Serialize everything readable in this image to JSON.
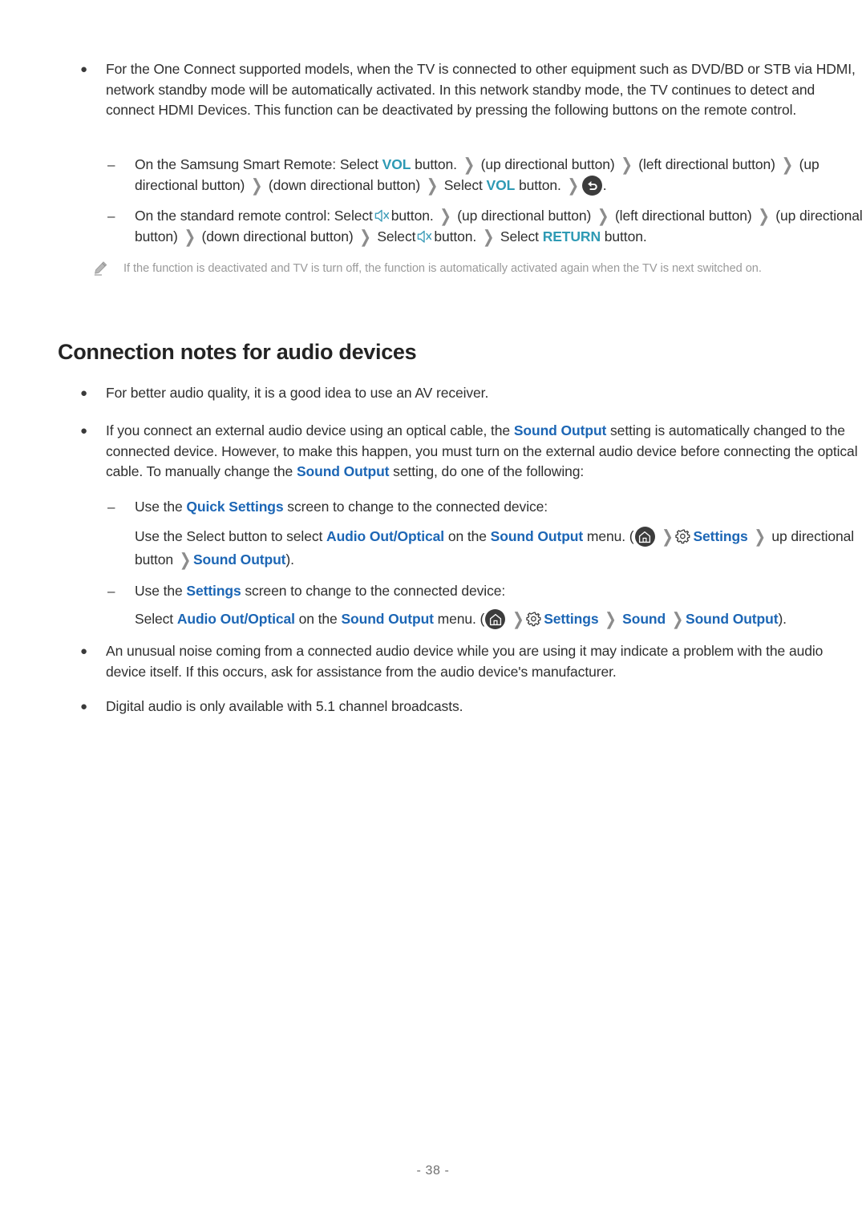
{
  "document": {
    "page_number": "- 38 -",
    "colors": {
      "link_blue": "#1c66b5",
      "remote_key_teal": "#2e9ab4",
      "body_text": "#2f2f2f",
      "note_text": "#9a9a9a",
      "heading": "#232323",
      "icon_dark": "#3c3c3c"
    }
  },
  "bullets": {
    "one_connect": {
      "marker": "●",
      "text": "For the One Connect supported models, when the TV is connected to other equipment such as DVD/BD or STB via HDMI, network standby mode will be automatically activated. In this network standby mode, the TV continues to detect and connect HDMI Devices. This function can be deactivated by pressing the following buttons on the remote control."
    }
  },
  "smart_remote_step": {
    "marker": "–",
    "seg1": "On the Samsung Smart Remote: Select",
    "key1": "VOL",
    "seg2": "button.",
    "chev": "❯",
    "seg3": "(up directional button)",
    "seg4": "(left directional button)",
    "seg5": "(up directional button)",
    "seg6": "(down directional button)",
    "seg7": "Select",
    "key2": "VOL",
    "seg8": "button.",
    "return_icon": "return-icon",
    "seg9": "."
  },
  "standard_remote_step": {
    "marker": "–",
    "seg1": "On the standard remote control: Select",
    "mute_icon": "mute-icon",
    "seg2": "button.",
    "seg3": "(up directional button)",
    "seg4": "(left directional button)",
    "seg5": "(up directional button)",
    "seg6": "(down directional button)",
    "seg7": "Select",
    "seg8": "button.",
    "seg9": "Select",
    "key_return": "RETURN",
    "seg10": "button."
  },
  "note": {
    "icon": "pencil-icon",
    "text": "If the function is deactivated and TV is turn off, the function is automatically activated again when the TV is next switched on."
  },
  "section": {
    "title": "Connection notes for audio devices",
    "bullet_av_receiver": {
      "marker": "●",
      "text": "For better audio quality, it is a good idea to use an AV receiver."
    },
    "bullet_optical": {
      "marker": "●",
      "seg1": "If you connect an external audio device using an optical cable, the",
      "link1": "Sound Output",
      "seg2": "setting is automatically changed to the connected device. However, to make this happen, you must turn on the external audio device before connecting the optical cable. To manually change the",
      "link2": "Sound Output",
      "seg3": "setting, do one of the following:"
    },
    "quick_settings_step": {
      "marker": "–",
      "seg1": "Use the",
      "link1": "Quick Settings",
      "seg2": "screen to change to the connected device:"
    },
    "quick_settings_detail": {
      "seg1": "Use the Select button to select",
      "link1": "Audio Out/Optical",
      "seg2": "on the",
      "link2": "Sound Output",
      "seg3": "menu. (",
      "home_icon": "home-icon",
      "chev": "❯",
      "gear_icon": "gear-icon",
      "link3": "Settings",
      "seg4": "up directional button",
      "link4": "Sound Output",
      "seg5": ")."
    },
    "settings_step": {
      "marker": "–",
      "seg1": "Use the",
      "link1": "Settings",
      "seg2": "screen to change to the connected device:"
    },
    "settings_detail": {
      "seg1": "Select",
      "link1": "Audio Out/Optical",
      "seg2": "on the",
      "link2": "Sound Output",
      "seg3": "menu. (",
      "home_icon": "home-icon",
      "chev": "❯",
      "gear_icon": "gear-icon",
      "link3": "Settings",
      "link4": "Sound",
      "link5": "Sound Output",
      "seg4": ")."
    },
    "bullet_noise": {
      "marker": "●",
      "text": "An unusual noise coming from a connected audio device while you are using it may indicate a problem with the audio device itself. If this occurs, ask for assistance from the audio device's manufacturer."
    },
    "bullet_digital": {
      "marker": "●",
      "text": "Digital audio is only available with 5.1 channel broadcasts."
    }
  }
}
